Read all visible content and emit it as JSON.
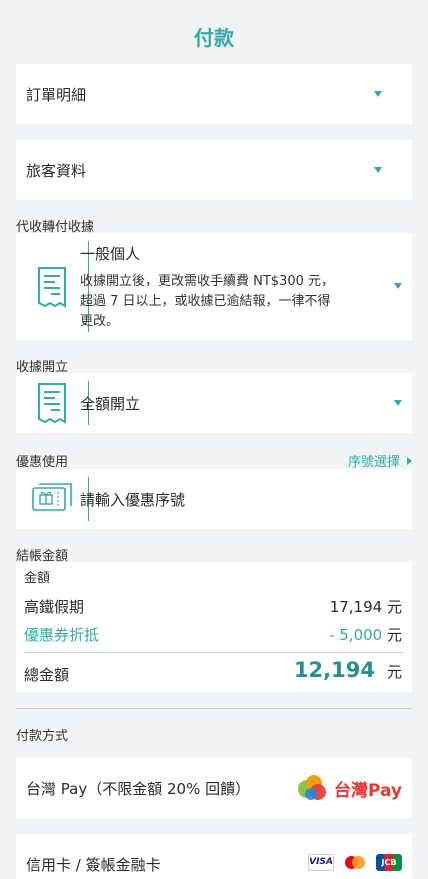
{
  "page": {
    "title": "付款"
  },
  "sections": {
    "order_details": "訂單明細",
    "traveler_info": "旅客資料",
    "receipt_label": "代收轉付收據",
    "receipt_type": "一般個人",
    "receipt_note_1": "收據開立後，更改需收手續費 NT$300 元，",
    "receipt_note_2": "超過 7 日以上，或收據已逾結報，一律不得",
    "receipt_note_3": "更改。",
    "issue_label": "收據開立",
    "issue_value": "全額開立",
    "discount_label": "優惠使用",
    "discount_link": "序號選擇",
    "discount_placeholder": "請輸入優惠序號",
    "checkout_label": "結帳金額"
  },
  "checkout": {
    "amount_header": "金額",
    "item_name": "高鐵假期",
    "item_amount": "17,194",
    "coupon_name": "優惠券折抵",
    "coupon_amount": "- 5,000",
    "currency": "元",
    "total_label": "總金額",
    "total_amount": "12,194"
  },
  "payment": {
    "label": "付款方式",
    "taiwan_pay": "台灣 Pay（不限金額 20% 回饋）",
    "taiwan_pay_logo_text": "台灣Pay",
    "credit_card": "信用卡 / 簽帳金融卡",
    "card_logos": {
      "visa": "VISA",
      "jcb": "JCB"
    }
  },
  "colors": {
    "accent": "#35a9a6",
    "background": "#f2f3f5",
    "card": "#ffffff"
  }
}
